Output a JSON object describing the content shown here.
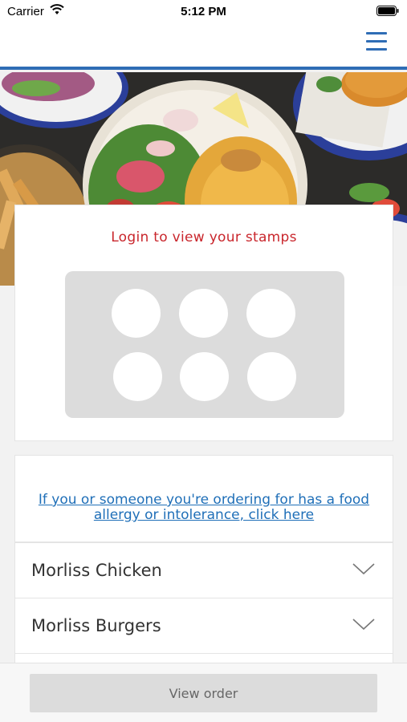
{
  "status_bar": {
    "carrier": "Carrier",
    "time": "5:12 PM"
  },
  "icons": {
    "wifi": "wifi-icon",
    "battery": "battery-icon",
    "menu": "hamburger-menu-icon",
    "chevron": "chevron-down-icon"
  },
  "hero": {
    "description": ""
  },
  "stamps": {
    "login_text": "Login to view your stamps",
    "count": 6
  },
  "allergy": {
    "link_text": "If you or someone you're ordering for has a food allergy or intolerance, click here"
  },
  "categories": [
    {
      "label": "Morliss Chicken"
    },
    {
      "label": "Morliss Burgers"
    }
  ],
  "footer": {
    "view_order_label": "View order"
  },
  "colors": {
    "brand_blue": "#2f6db5",
    "login_red": "#c9262c",
    "link_blue": "#1f6fb8"
  }
}
